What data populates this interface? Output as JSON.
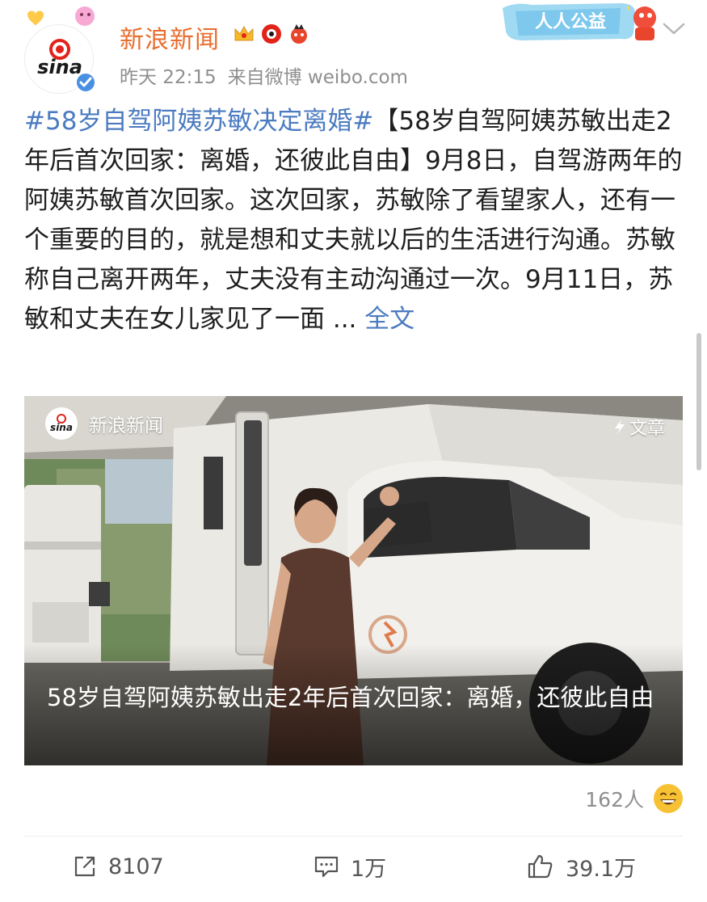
{
  "post": {
    "author": "新浪新闻",
    "avatar_text": "sina",
    "time": "昨天 22:15",
    "source": "来自微博 weibo.com",
    "charity_badge": "人人公益",
    "hashtag": "#58岁自驾阿姨苏敏决定离婚#",
    "body": "【58岁自驾阿姨苏敏出走2年后首次回家：离婚，还彼此自由】9月8日，自驾游两年的阿姨苏敏首次回家。这次回家，苏敏除了看望家人，还有一个重要的目的，就是想和丈夫就以后的生活进行沟通。苏敏称自己离开两年，丈夫没有主动沟通过一次。9月11日，苏敏和丈夫在女儿家见了一面",
    "ellipsis": " ... ",
    "more_label": "全文"
  },
  "card": {
    "source_name": "新浪新闻",
    "logo_text": "sina",
    "type_label": "文章",
    "title": "58岁自驾阿姨苏敏出走2年后首次回家：离婚，还彼此自由"
  },
  "readers": {
    "count": "162人"
  },
  "actions": {
    "repost": "8107",
    "comment": "1万",
    "like": "39.1万"
  },
  "colors": {
    "author": "#e86d2e",
    "link": "#4b7bc0",
    "meta": "#8f8f8f",
    "verified": "#4a90e2"
  },
  "icons": [
    "verified-icon",
    "crown-icon",
    "vip-icon",
    "fan-icon",
    "chevron-down-icon",
    "lightning-icon",
    "grin-emoji-icon",
    "repost-icon",
    "comment-icon",
    "like-icon"
  ]
}
